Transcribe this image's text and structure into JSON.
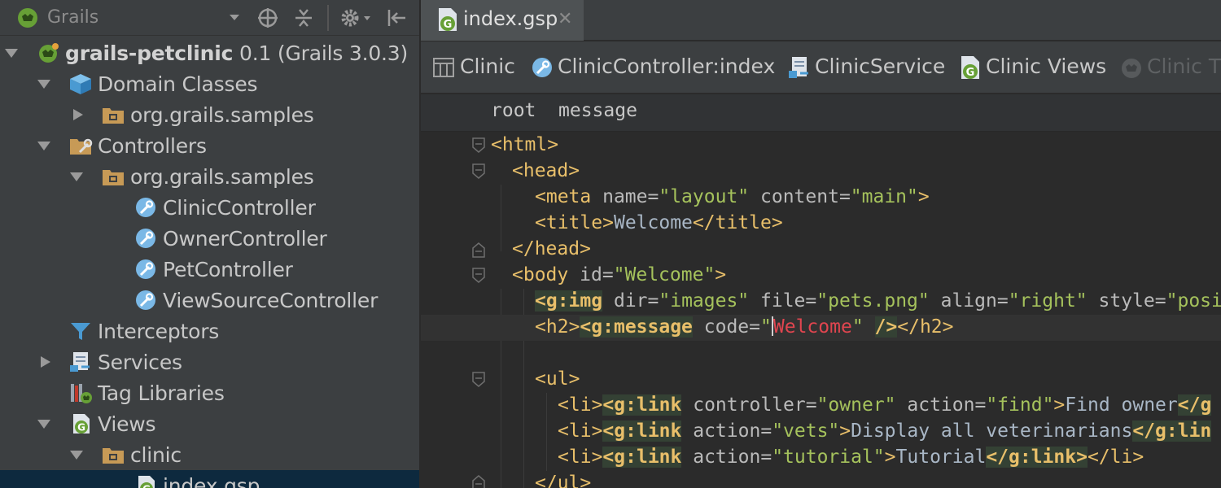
{
  "project_panel": {
    "title": "Grails",
    "tree": [
      {
        "label": "grails-petclinic",
        "suffix": " 0.1 (Grails 3.0.3)",
        "icon": "grails-project-icon",
        "expanded": true
      },
      {
        "label": "Domain Classes",
        "icon": "domain-classes-icon",
        "expanded": true
      },
      {
        "label": "org.grails.samples",
        "icon": "package-folder-icon",
        "expanded": false
      },
      {
        "label": "Controllers",
        "icon": "controllers-folder-icon",
        "expanded": true
      },
      {
        "label": "org.grails.samples",
        "icon": "package-folder-icon",
        "expanded": true
      },
      {
        "label": "ClinicController",
        "icon": "controller-icon"
      },
      {
        "label": "OwnerController",
        "icon": "controller-icon"
      },
      {
        "label": "PetController",
        "icon": "controller-icon"
      },
      {
        "label": "ViewSourceController",
        "icon": "controller-icon"
      },
      {
        "label": "Interceptors",
        "icon": "filter-icon"
      },
      {
        "label": "Services",
        "icon": "services-icon",
        "expanded": false
      },
      {
        "label": "Tag Libraries",
        "icon": "tag-libraries-icon"
      },
      {
        "label": "Views",
        "icon": "views-icon",
        "expanded": true
      },
      {
        "label": "clinic",
        "icon": "package-folder-icon",
        "expanded": true
      },
      {
        "label": "index.gsp",
        "icon": "gsp-file-icon",
        "selected": true
      }
    ]
  },
  "editor": {
    "tab": {
      "label": "index.gsp",
      "close": "✕"
    },
    "nav_bar": [
      {
        "label": "Clinic",
        "icon": "table-icon"
      },
      {
        "label": "ClinicController:index",
        "icon": "controller-icon"
      },
      {
        "label": "ClinicService",
        "icon": "services-icon"
      },
      {
        "label": "Clinic Views",
        "icon": "gsp-file-icon"
      },
      {
        "label": "Clinic T",
        "icon": "grails-tag-icon"
      }
    ],
    "breadcrumbs": [
      "root",
      "message"
    ],
    "code_text": {
      "l1": "html",
      "l2": "head",
      "l3_tag": "meta",
      "l3_a1": "name",
      "l3_v1": "\"layout\"",
      "l3_a2": "content",
      "l3_v2": "\"main\"",
      "l4_tag": "title",
      "l4_text": "Welcome",
      "l5": "head",
      "l6_tag": "body",
      "l6_a1": "id",
      "l6_v1": "\"Welcome\"",
      "l7_tag": "g:img",
      "l7_a1": "dir",
      "l7_v1": "\"images\"",
      "l7_a2": "file",
      "l7_v2": "\"pets.png\"",
      "l7_a3": "align",
      "l7_v3": "\"right\"",
      "l7_a4": "style",
      "l7_v4": "\"posi",
      "l8_tag": "h2",
      "l8_gtag": "g:message",
      "l8_a1": "code",
      "l8_v1": "Welcome",
      "l10_tag": "ul",
      "l11_tag": "li",
      "l11_gtag": "g:link",
      "l11_a1": "controller",
      "l11_v1": "\"owner\"",
      "l11_a2": "action",
      "l11_v2": "\"find\"",
      "l11_text": "Find owner",
      "l11_end": "g",
      "l12_tag": "li",
      "l12_gtag": "g:link",
      "l12_a1": "action",
      "l12_v1": "\"vets\"",
      "l12_text": "Display all veterinarians",
      "l12_end": "g:lin",
      "l13_tag": "li",
      "l13_gtag": "g:link",
      "l13_a1": "action",
      "l13_v1": "\"tutorial\"",
      "l13_text": "Tutorial",
      "l13_end": "g:link",
      "l13_li": "li",
      "l14": "ul"
    }
  },
  "colors": {
    "tag": "#e8bf6a",
    "attribute": "#bababa",
    "value": "#a5c25c",
    "error": "#e0454f",
    "selection": "#0d293e"
  }
}
